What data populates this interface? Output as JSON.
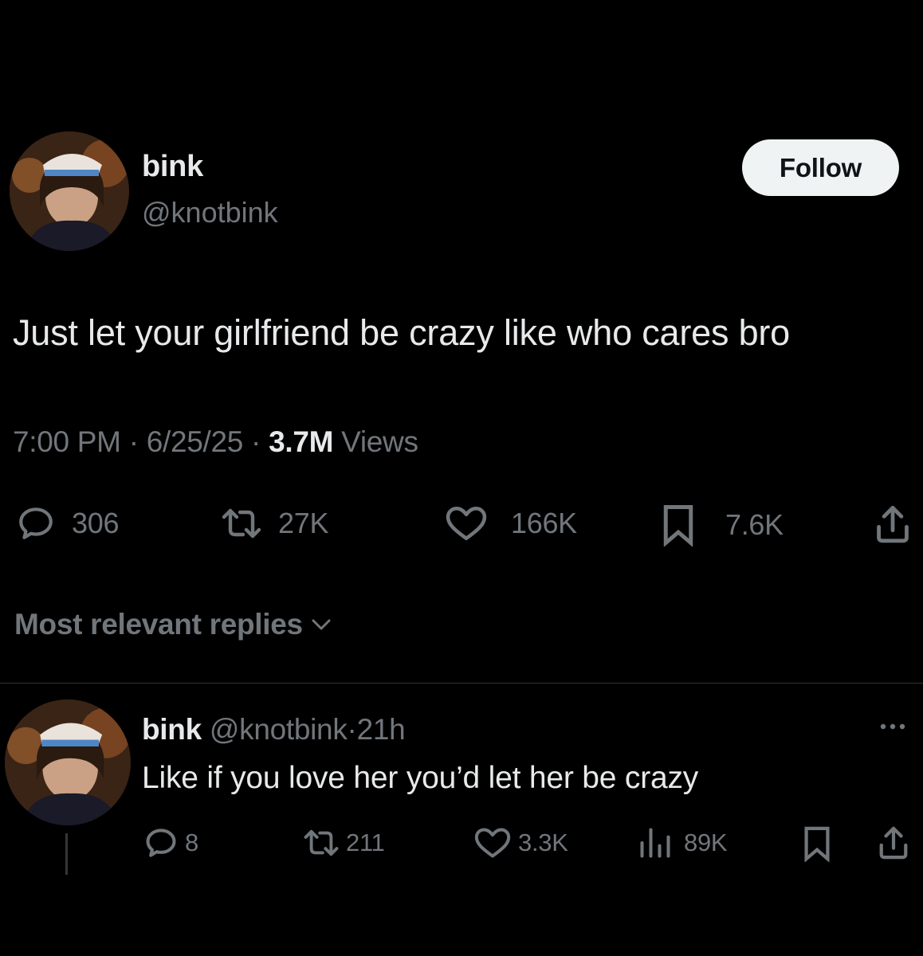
{
  "tweet": {
    "display_name": "bink",
    "handle": "@knotbink",
    "follow_label": "Follow",
    "text": "Just let your girlfriend be crazy like who cares bro",
    "time": "7:00 PM",
    "date": "6/25/25",
    "views_count": "3.7M",
    "views_label": "Views",
    "separator": "·",
    "actions": {
      "replies": "306",
      "reposts": "27K",
      "likes": "166K",
      "bookmarks": "7.6K"
    }
  },
  "replies_section": {
    "sort_label": "Most relevant replies"
  },
  "reply": {
    "display_name": "bink",
    "handle": "@knotbink",
    "separator": "·",
    "age": "21h",
    "text": "Like if you love her you’d let her be crazy",
    "actions": {
      "replies": "8",
      "reposts": "211",
      "likes": "3.3K",
      "views": "89K"
    }
  },
  "colors": {
    "background": "#000000",
    "text_primary": "#e7e9ea",
    "text_muted": "#71767b",
    "follow_bg": "#eff3f4",
    "divider": "#2f3336"
  },
  "icons": {
    "reply": "speech-bubble-icon",
    "repost": "repost-arrows-icon",
    "like": "heart-icon",
    "bookmark": "bookmark-icon",
    "share": "share-upload-icon",
    "views": "bar-chart-icon",
    "more": "more-dots-icon",
    "sort": "chevron-down-icon"
  }
}
